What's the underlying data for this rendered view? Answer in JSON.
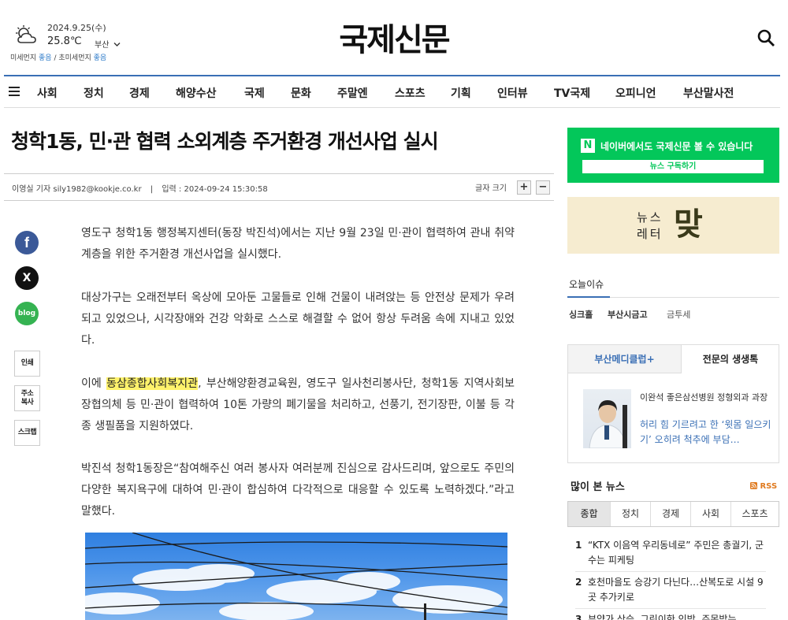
{
  "weather": {
    "date": "2024.9.25(수)",
    "temp": "25.8℃",
    "region": "부산",
    "dust_label": "미세먼지",
    "dust_value": "좋음",
    "ultra_label": "초미세먼지",
    "ultra_value": "좋음"
  },
  "site": {
    "logo": "국제신문"
  },
  "nav": {
    "items": [
      "사회",
      "정치",
      "경제",
      "해양수산",
      "국제",
      "문화",
      "주말엔",
      "스포츠",
      "기획",
      "인터뷰",
      "TV국제",
      "오피니언",
      "부산말사전"
    ]
  },
  "article": {
    "title": "청학1동, 민·관 협력 소외계층 주거환경 개선사업 실시",
    "byline": "이영실 기자 sily1982@kookje.co.kr",
    "sep": "|",
    "published": "입력 : 2024-09-24 15:30:58",
    "font_size_label": "글자 크기",
    "p1": "영도구 청학1동 행정복지센터(동장 박진석)에서는 지난 9월 23일 민·관이 협력하여 관내 취약계층을 위한 주거환경 개선사업을 실시했다.",
    "p2": "대상가구는 오래전부터 옥상에 모아둔 고물들로 인해 건물이 내려앉는 등 안전상 문제가 우려되고 있었으나, 시각장애와 건강 악화로 스스로 해결할 수 없어 항상 두려움 속에 지내고 있었다.",
    "p3_pre": "이에 ",
    "p3_highlight": "동삼종합사회복지관",
    "p3_post": ", 부산해양환경교육원, 영도구 일사천리봉사단, 청학1동 지역사회보장협의체 등 민·관이 협력하여 10톤 가량의 폐기물을 처리하고, 선풍기, 전기장판, 이불 등 각종 생필품을 지원하였다.",
    "p4": "박진석 청학1동장은“참여해주신 여러 봉사자 여러분께 진심으로 감사드리며, 앞으로도 주민의 다양한 복지욕구에 대하여 민·관이 합심하여 다각적으로 대응할 수 있도록 노력하겠다.”라고 말했다."
  },
  "tools": {
    "print": "인쇄",
    "copy_url": "주소\n복사",
    "scrap": "스크랩"
  },
  "social": {
    "facebook": "f",
    "x": "X",
    "blog": "blog"
  },
  "sidebar": {
    "naver_text": "네이버에서도 국제신문 볼 수 있습니다",
    "naver_button": "뉴스 구독하기",
    "naver_logo": "N",
    "newsletter_text1": "뉴스",
    "newsletter_text2": "레터",
    "newsletter_brand": "맞",
    "today_issue_heading": "오늘이슈",
    "issues": [
      "싱크홀",
      "부산시금고",
      "금투세"
    ],
    "tab_left": "부산메디클럽+",
    "tab_right": "전문의 생생톡",
    "doctor_name": "이완석 좋은삼선병원 정형외과 과장",
    "doctor_title": "허리 힘 기르려고 한 ‘윗몸 일으키기’ 오히려 척추에 부담…",
    "popular_heading": "많이 본 뉴스",
    "rss": "RSS",
    "popular_tabs": [
      "종합",
      "정치",
      "경제",
      "사회",
      "스포츠"
    ],
    "popular_items": [
      {
        "num": "1",
        "text": "“KTX 이음역 우리동네로” 주민은 총궐기, 군수는 피케팅"
      },
      {
        "num": "2",
        "text": "호천마을도 승강기 다닌다…산복도로 시설 9곳 추가키로"
      },
      {
        "num": "3",
        "text": "부양가 상승, 그린이한 인방, 주목받는"
      }
    ]
  },
  "colors": {
    "accent": "#3a6fb5",
    "naver": "#03c75a",
    "highlight": "#fff26b",
    "facebook": "#3b5998",
    "blog": "#35b352"
  }
}
